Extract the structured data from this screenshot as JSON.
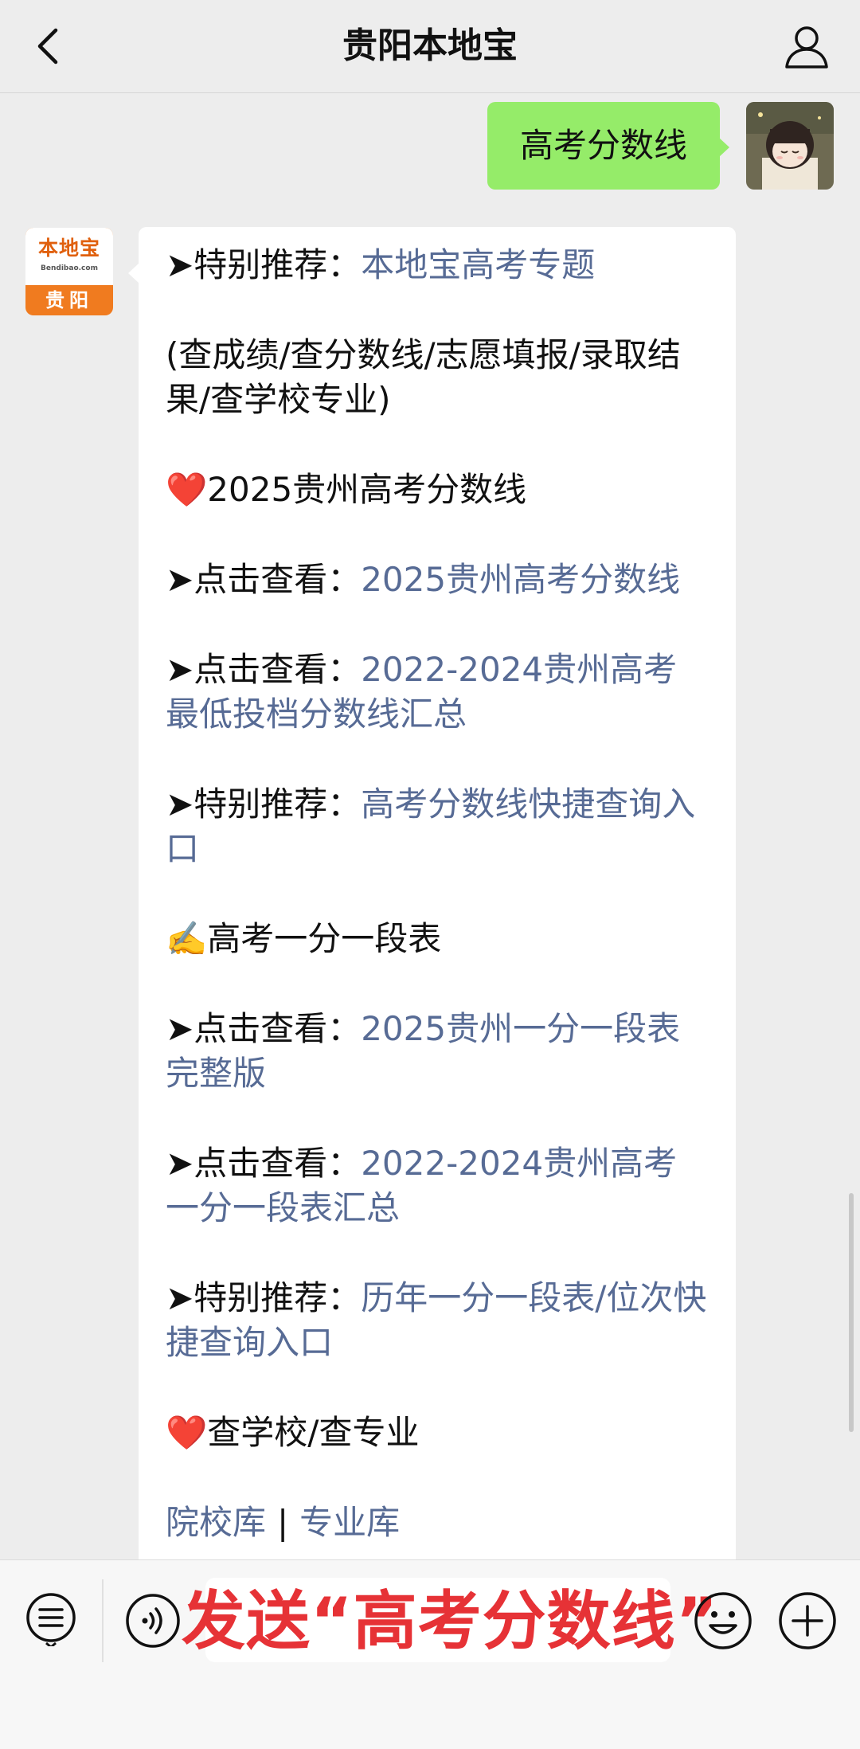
{
  "header": {
    "title": "贵阳本地宝"
  },
  "sent_message": {
    "text": "高考分数线"
  },
  "bot_avatar": {
    "brand": "本地宝",
    "url": "Bendibao.com",
    "city": "贵阳"
  },
  "reply": {
    "line1_prefix": "➤特别推荐：",
    "line1_link": "本地宝高考专题",
    "line2": "(查成绩/查分数线/志愿填报/录取结果/查学校专业)",
    "section1_heart": "❤️",
    "section1_title": "2025贵州高考分数线",
    "line3_prefix": "➤点击查看：",
    "line3_link": "2025贵州高考分数线",
    "line4_prefix": "➤点击查看：",
    "line4_link": "2022-2024贵州高考最低投档分数线汇总",
    "line5_prefix": "➤特别推荐：",
    "line5_link": "高考分数线快捷查询入口",
    "section2_icon": "✍️",
    "section2_title": "高考一分一段表",
    "line6_prefix": "➤点击查看：",
    "line6_link": "2025贵州一分一段表完整版",
    "line7_prefix": "➤点击查看：",
    "line7_link": "2022-2024贵州高考一分一段表汇总",
    "line8_prefix": "➤特别推荐：",
    "line8_link": "历年一分一段表/位次快捷查询入口",
    "section3_heart": "❤️",
    "section3_title": "查学校/查专业",
    "link_school": "院校库",
    "separator": "|",
    "link_major": "专业库"
  },
  "toolbar": {
    "overlay_text": "发送“高考分数线”"
  },
  "colors": {
    "link": "#576b95",
    "sent_bubble": "#95ec69",
    "overlay_text": "#e63236",
    "bot_avatar_orange": "#f07b1f"
  },
  "icons": [
    "back-icon",
    "user-icon",
    "menu-icon",
    "voice-icon",
    "emoji-icon",
    "plus-icon",
    "heart-icon",
    "writing-hand-icon"
  ]
}
